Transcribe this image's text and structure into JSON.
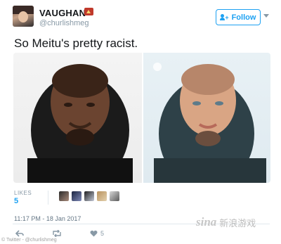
{
  "header": {
    "display_name": "VAUGHAN",
    "handle": "@churlishmeg",
    "follow_label": "Follow"
  },
  "tweet": {
    "text": "So Meitu's pretty racist."
  },
  "engagement": {
    "likes_label": "LIKES",
    "likes_count": "5",
    "timestamp": "11:17 PM - 18 Jan 2017",
    "like_action_count": "5"
  },
  "footer": {
    "credit": "© Twitter - @churlishmeg",
    "watermark_logo": "sina",
    "watermark_text": "新浪游戏"
  },
  "colors": {
    "accent": "#1da1f2",
    "muted": "#8899a6"
  },
  "icons": {
    "follow": "follow-person-plus-icon",
    "caret": "chevron-down-icon",
    "reply": "reply-icon",
    "retweet": "retweet-icon",
    "like": "heart-icon"
  }
}
